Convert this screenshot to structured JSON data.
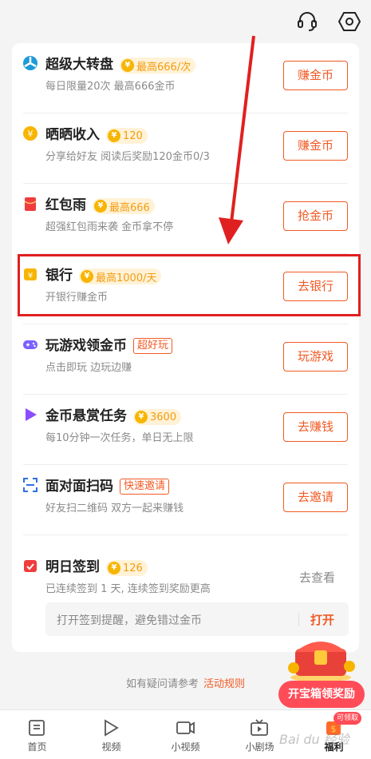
{
  "colors": {
    "accent": "#f15a24",
    "coin": "#f7b500",
    "highlight": "#e02020",
    "chest_button": "#ff4c57"
  },
  "topbar": {
    "icons": [
      "headset-icon",
      "hexagon-settings-icon"
    ]
  },
  "tasks": [
    {
      "title": "超级大转盘",
      "badge": "最高666/次",
      "subtitle": "每日限量20次 最高666金币",
      "button": "赚金币",
      "icon": "wheel-icon"
    },
    {
      "title": "晒晒收入",
      "badge": "120",
      "subtitle": "分享给好友 阅读后奖励120金币0/3",
      "button": "赚金币",
      "icon": "coin-icon"
    },
    {
      "title": "红包雨",
      "badge": "最高666",
      "subtitle": "超强红包雨来袭 金币拿不停",
      "button": "抢金币",
      "icon": "red-envelope-icon"
    },
    {
      "title": "银行",
      "badge": "最高1000/天",
      "subtitle": "开银行赚金币",
      "button": "去银行",
      "icon": "bank-icon"
    },
    {
      "title": "玩游戏领金币",
      "tag": "超好玩",
      "subtitle": "点击即玩 边玩边赚",
      "button": "玩游戏",
      "icon": "gamepad-icon"
    },
    {
      "title": "金币悬赏任务",
      "badge": "3600",
      "subtitle": "每10分钟一次任务，单日无上限",
      "button": "去赚钱",
      "icon": "play-triangle-icon"
    },
    {
      "title": "面对面扫码",
      "tag": "快速邀请",
      "subtitle": "好友扫二维码 双方一起来赚钱",
      "button": "去邀请",
      "icon": "scan-icon"
    }
  ],
  "signin": {
    "title": "明日签到",
    "badge": "126",
    "subtitle": "已连续签到 1 天, 连续签到奖励更高",
    "see_label": "去查看",
    "reminder_hint": "打开签到提醒，避免错过金币",
    "reminder_button": "打开"
  },
  "footer": {
    "note": "如有疑问请参考",
    "link": "活动规则"
  },
  "chest": {
    "button": "开宝箱领奖励"
  },
  "tabbar": {
    "tabs": [
      {
        "label": "首页",
        "icon": "home-icon"
      },
      {
        "label": "视频",
        "icon": "video-play-icon"
      },
      {
        "label": "小视频",
        "icon": "camera-icon"
      },
      {
        "label": "小剧场",
        "icon": "tv-icon"
      },
      {
        "label": "福利",
        "icon": "gift-icon"
      }
    ],
    "pill": "可领取"
  },
  "watermark": "Bai du 经验"
}
